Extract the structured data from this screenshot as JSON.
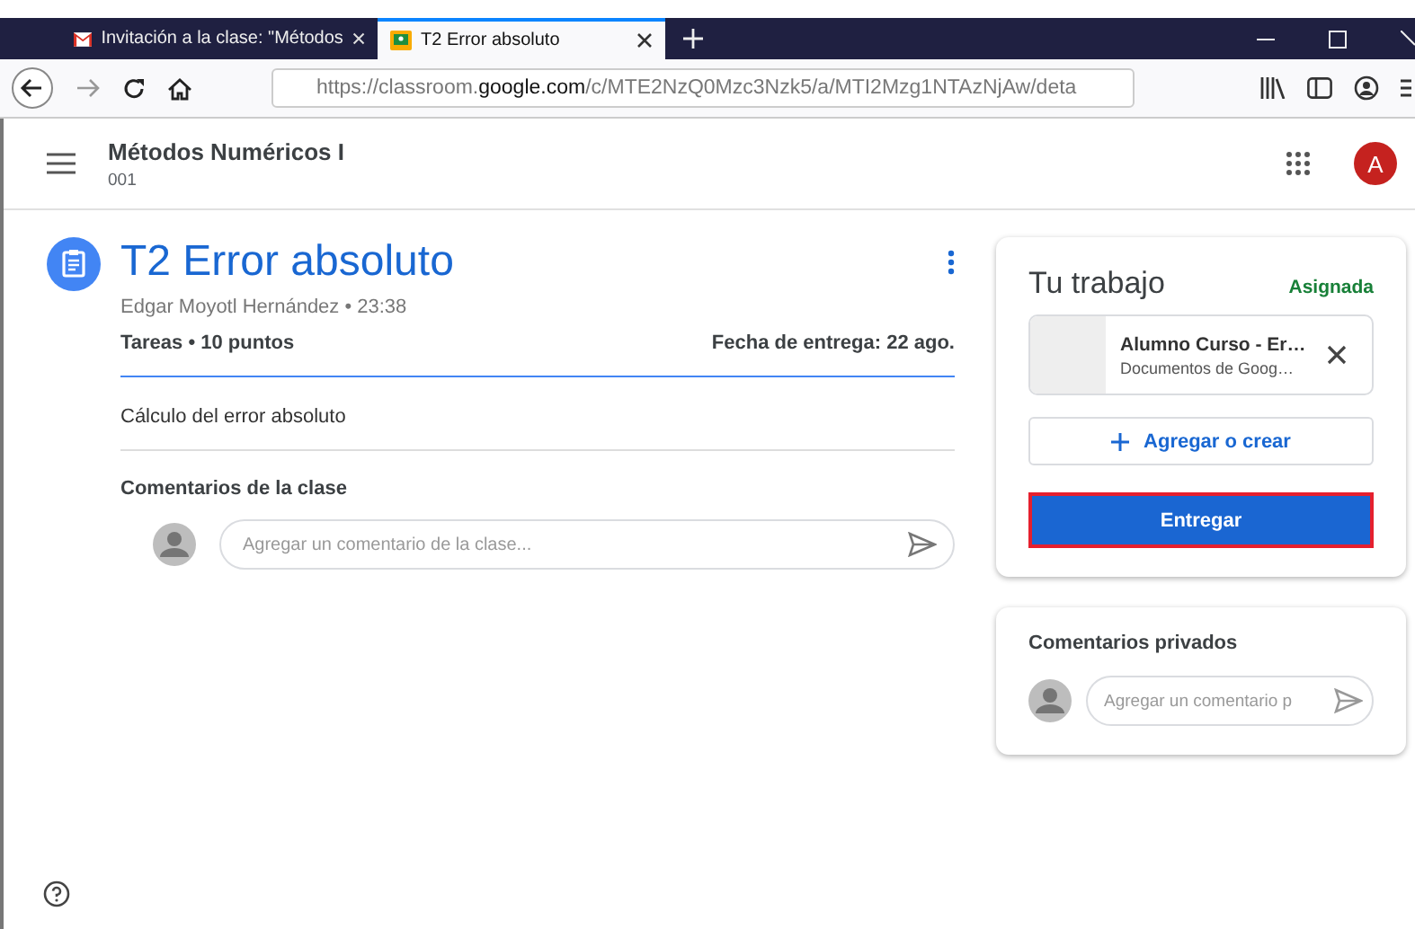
{
  "browser": {
    "tabs": [
      {
        "title": "Invitación a la clase: \"Métodos",
        "selected": false,
        "kind": "mail"
      },
      {
        "title": "T2 Error absoluto",
        "selected": true,
        "kind": "classroom"
      }
    ],
    "url_prefix": "https://classroom.",
    "url_domain": "google.com",
    "url_rest": "/c/MTE2NzQ0Mzc3Nzk5/a/MTI2Mzg1NTAzNjAw/deta"
  },
  "class_header": {
    "title": "Métodos Numéricos I",
    "section": "001",
    "avatar": "A"
  },
  "assignment": {
    "title": "T2 Error absoluto",
    "author_time": "Edgar Moyotl Hernández • 23:38",
    "type_points": "Tareas • 10 puntos",
    "due": "Fecha de entrega: 22 ago.",
    "description": "Cálculo del error absoluto",
    "comments_heading": "Comentarios de la clase",
    "comment_placeholder": "Agregar un comentario de la clase..."
  },
  "your_work": {
    "heading": "Tu trabajo",
    "status": "Asignada",
    "attachment": {
      "title": "Alumno Curso - Er…",
      "subtitle": "Documentos de Goog…"
    },
    "add_button": "Agregar o crear",
    "submit_button": "Entregar"
  },
  "private_comments": {
    "heading": "Comentarios privados",
    "placeholder": "Agregar un comentario p"
  }
}
